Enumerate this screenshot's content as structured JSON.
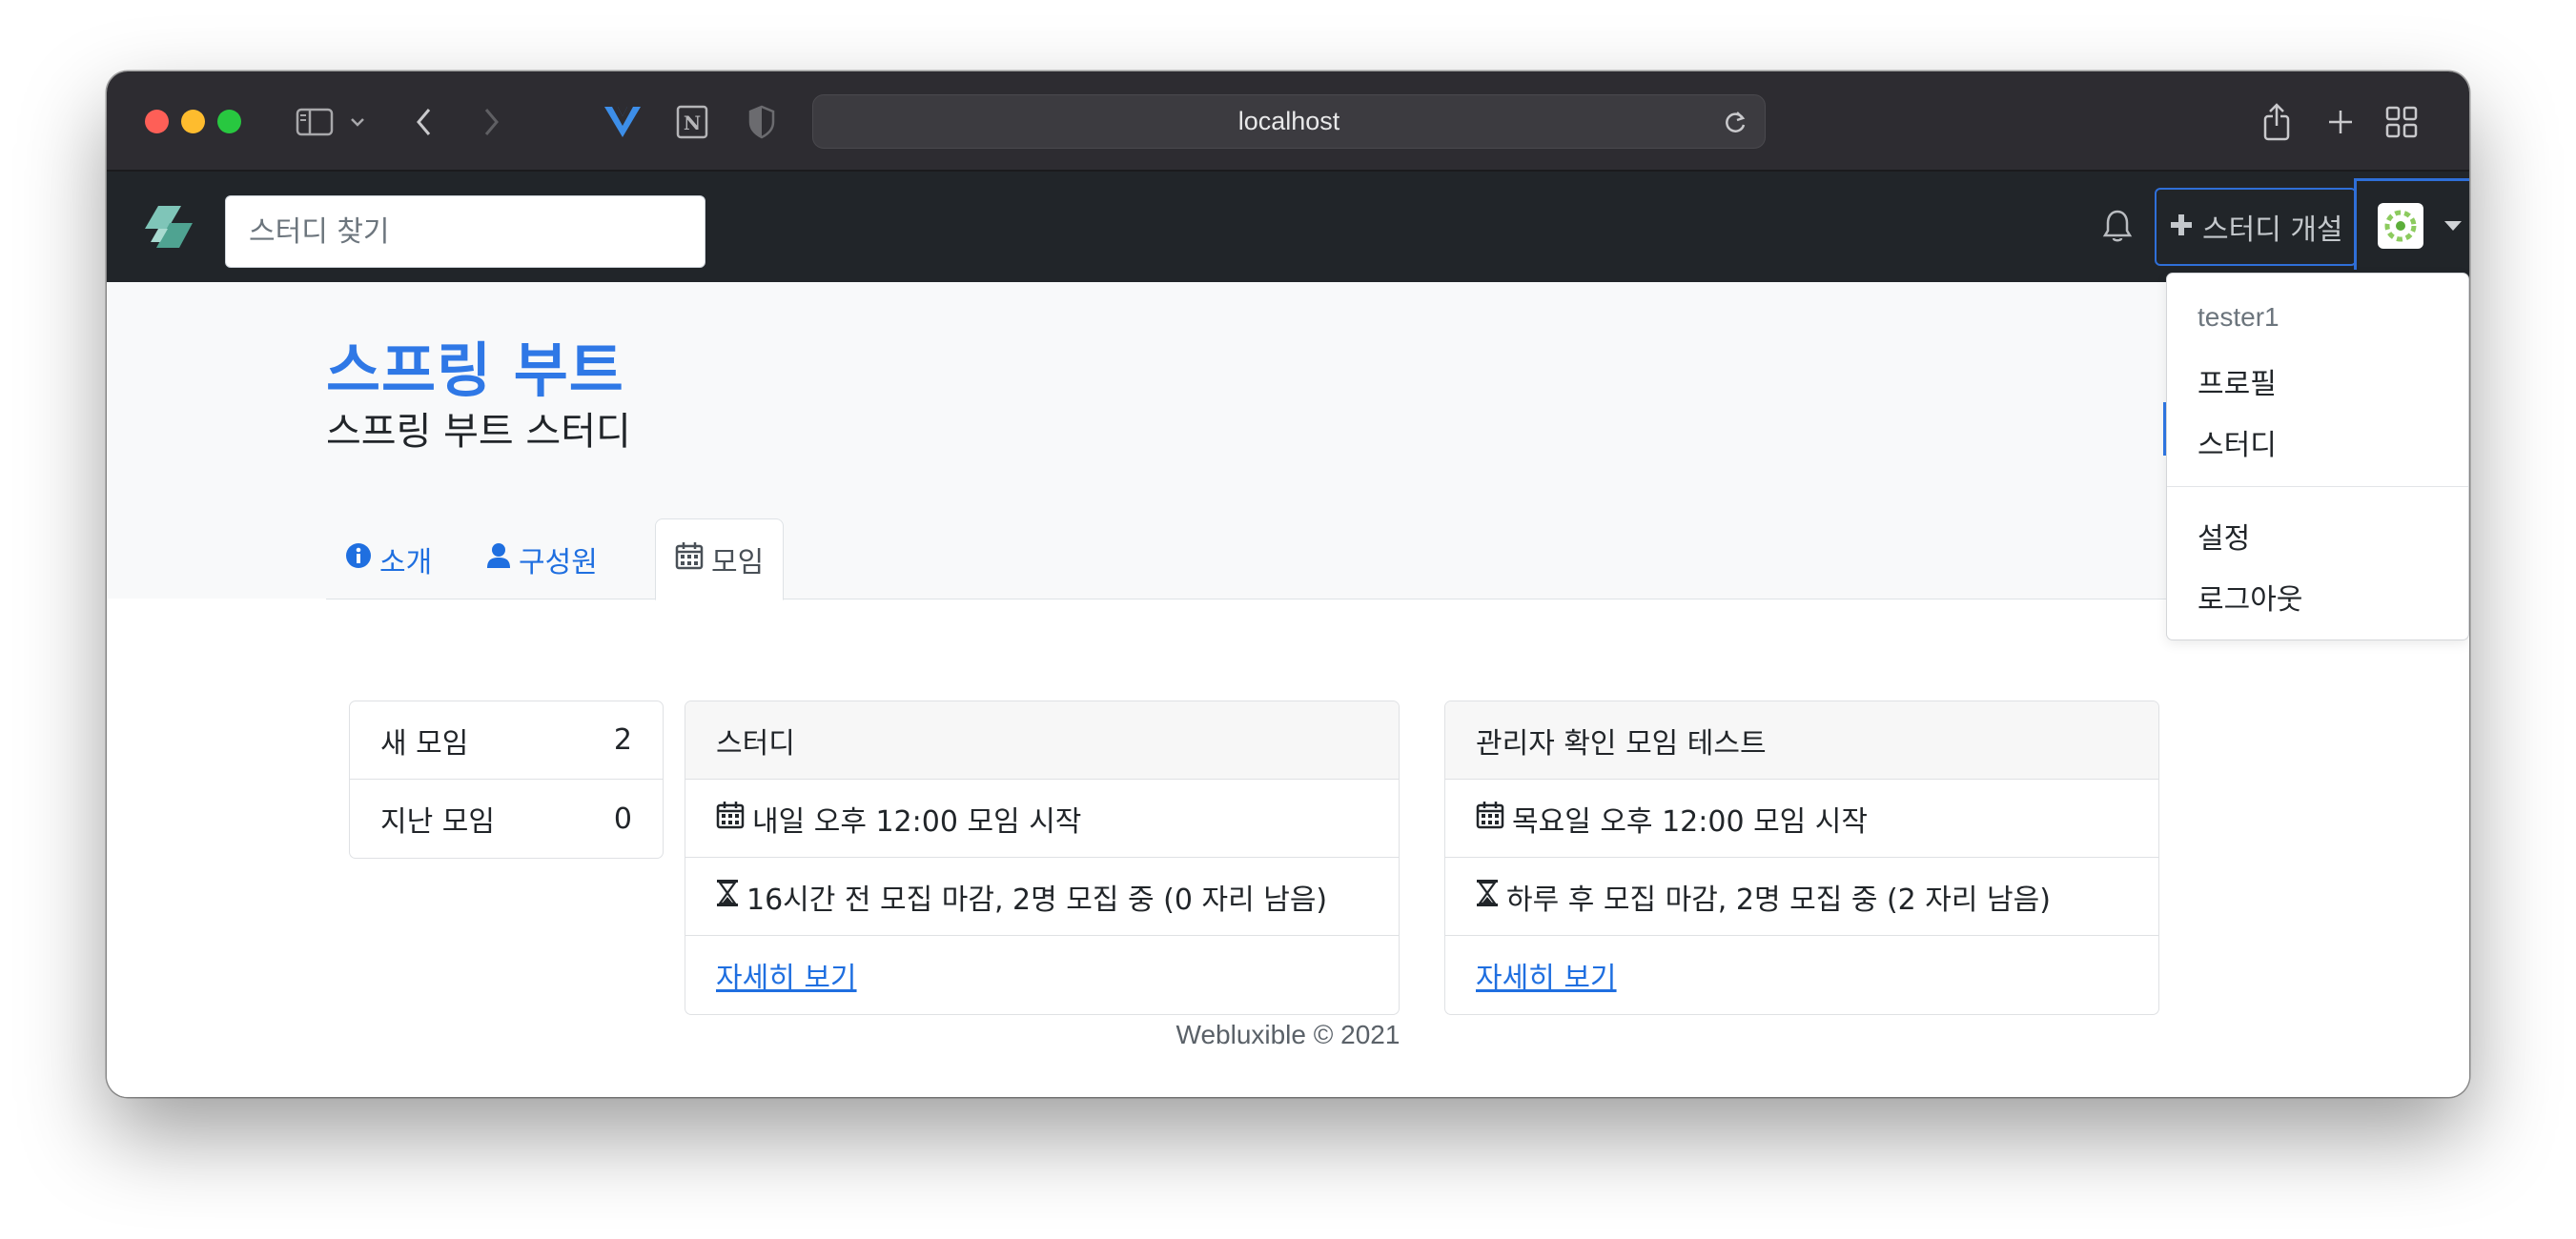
{
  "browser": {
    "url": "localhost"
  },
  "navbar": {
    "search_placeholder": "스터디 찾기",
    "create_label": "스터디 개설"
  },
  "study": {
    "title": "스프링 부트",
    "subtitle": "스프링 부트 스터디"
  },
  "tabs": [
    {
      "label": "소개",
      "icon": "info-circle-icon"
    },
    {
      "label": "구성원",
      "icon": "user-icon"
    },
    {
      "label": "모임",
      "icon": "calendar-icon",
      "active": true
    }
  ],
  "summary": {
    "new_label": "새 모임",
    "new_count": "2",
    "past_label": "지난 모임",
    "past_count": "0"
  },
  "events": [
    {
      "title": "스터디",
      "start": "내일 오후 12:00 모임 시작",
      "deadline": "16시간 전 모집 마감, 2명 모집 중 (0 자리 남음)",
      "detail_link": "자세히 보기"
    },
    {
      "title": "관리자 확인 모임 테스트",
      "start": "목요일 오후 12:00 모임 시작",
      "deadline": "하루 후 모집 마감, 2명 모집 중 (2 자리 남음)",
      "detail_link": "자세히 보기"
    }
  ],
  "footer": {
    "text": "Webluxible © 2021"
  },
  "dropdown": {
    "username": "tester1",
    "profile": "프로필",
    "study": "스터디",
    "settings": "설정",
    "logout": "로그아웃"
  },
  "colors": {
    "accent": "#2f78e6",
    "navbar": "#212529",
    "titlebar": "#2d2c31"
  }
}
